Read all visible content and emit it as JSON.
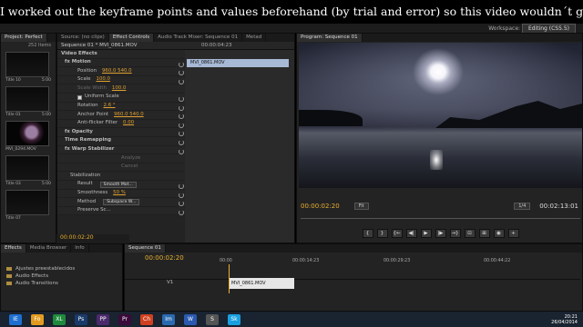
{
  "caption": "I worked out the keyframe points and values beforehand (by trial and error) so this video wouldn´t go on for too long.",
  "workspace": {
    "label": "Workspace:",
    "value": "Editing (CS5.5)"
  },
  "project": {
    "tab": "Project: Perfect",
    "count": "252 Items",
    "items": [
      {
        "label": "Title 10",
        "dur": "5:00",
        "style": "dark"
      },
      {
        "label": "Title 01",
        "dur": "5:00",
        "style": "dark"
      },
      {
        "label": "MVI_0294.MOV",
        "dur": "",
        "style": "moon"
      },
      {
        "label": "Title 03",
        "dur": "5:00",
        "style": "dark"
      },
      {
        "label": "Title 07",
        "dur": "",
        "style": "dark"
      }
    ]
  },
  "effect_controls": {
    "tabs": [
      "Source: (no clips)",
      "Effect Controls",
      "Audio Track Mixer: Sequence 01",
      "Metad"
    ],
    "header": "Sequence 01 * MVI_0861.MOV",
    "timecode": "00:00:04:23",
    "clip_name": "MVI_0861.MOV",
    "rows": [
      {
        "label": "Video Effects",
        "val": "",
        "kind": "section"
      },
      {
        "label": "fx Motion",
        "val": "",
        "kind": "group"
      },
      {
        "label": "Position",
        "val": "960.0   540.0",
        "kind": "prop"
      },
      {
        "label": "Scale",
        "val": "100.0",
        "kind": "prop"
      },
      {
        "label": "Scale Width",
        "val": "100.0",
        "kind": "disabled"
      },
      {
        "label": "Uniform Scale",
        "val": "",
        "kind": "check"
      },
      {
        "label": "Rotation",
        "val": "2.6 °",
        "kind": "prop"
      },
      {
        "label": "Anchor Point",
        "val": "960.0   540.0",
        "kind": "prop"
      },
      {
        "label": "Anti-flicker Filter",
        "val": "0.00",
        "kind": "prop"
      },
      {
        "label": "fx Opacity",
        "val": "",
        "kind": "group"
      },
      {
        "label": "Time Remapping",
        "val": "",
        "kind": "group"
      },
      {
        "label": "fx Warp Stabilizer",
        "val": "",
        "kind": "group"
      },
      {
        "label": "Analyze",
        "val": "",
        "kind": "button"
      },
      {
        "label": "Cancel",
        "val": "",
        "kind": "button"
      },
      {
        "label": "Stabilization",
        "val": "",
        "kind": "sub"
      },
      {
        "label": "Result",
        "val": "Smooth Mot...",
        "kind": "select"
      },
      {
        "label": "Smoothness",
        "val": "50 %",
        "kind": "prop"
      },
      {
        "label": "Method",
        "val": "Subspace W...",
        "kind": "select"
      },
      {
        "label": "Preserve Sc...",
        "val": "",
        "kind": "prop"
      }
    ],
    "footer_tc": "00:00:02:20"
  },
  "program": {
    "tab": "Program: Sequence 01",
    "timecode": "00:00:02:20",
    "fit": "Fit",
    "res": "1/4",
    "duration": "00:02:13:01",
    "transport": [
      "{",
      "}",
      "{←",
      "◀|",
      "▶",
      "|▶",
      "→}",
      "⊡",
      "⊞",
      "◉",
      "+"
    ]
  },
  "effects_panel": {
    "tabs": [
      "Effects",
      "Media Browser",
      "Info"
    ],
    "items": [
      "Ajustes preestablecidos",
      "Audio Effects",
      "Audio Transitions"
    ]
  },
  "timeline": {
    "tab": "Sequence 01",
    "timecode": "00:00:02:20",
    "ruler": [
      "00:00",
      "00:00:14:23",
      "00:00:29:23",
      "00:00:44:22"
    ],
    "track": "V1",
    "clip": "MVI_0861.MOV"
  },
  "taskbar": {
    "icons": [
      "IE",
      "Fo",
      "XL",
      "Ps",
      "PP",
      "Pr",
      "Ch",
      "Im",
      "W",
      "S",
      "Sk"
    ],
    "time": "20:21",
    "date": "26/04/2014"
  }
}
